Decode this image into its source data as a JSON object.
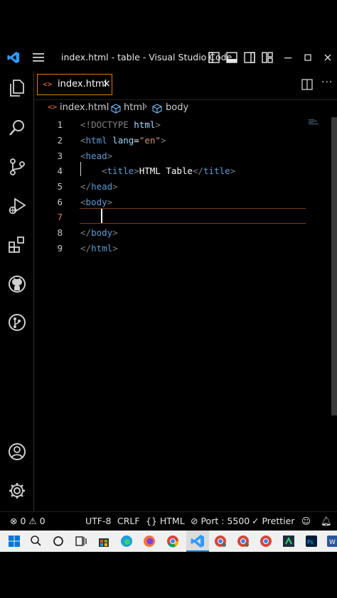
{
  "window": {
    "title": "index.html - table - Visual Studio Code"
  },
  "tab": {
    "icon": "<>",
    "label": "index.html",
    "close": "×"
  },
  "breadcrumb": {
    "file": "index.html",
    "items": [
      "html",
      "body"
    ]
  },
  "editor": {
    "lines": [
      {
        "n": "1"
      },
      {
        "n": "2"
      },
      {
        "n": "3"
      },
      {
        "n": "4"
      },
      {
        "n": "5"
      },
      {
        "n": "6"
      },
      {
        "n": "7"
      },
      {
        "n": "8"
      },
      {
        "n": "9"
      }
    ],
    "code": {
      "l1_open": "<!",
      "l1_kw": "DOCTYPE",
      "l1_rest": " html",
      "l1_close": ">",
      "l2_open": "<",
      "l2_tag": "html",
      "l2_attr": " lang",
      "l2_eq": "=",
      "l2_val": "\"en\"",
      "l2_close": ">",
      "l3_open": "<",
      "l3_tag": "head",
      "l3_close": ">",
      "l4_open": "<",
      "l4_tag": "title",
      "l4_close": ">",
      "l4_text": "HTML Table",
      "l4_end_open": "</",
      "l4_end_tag": "title",
      "l4_end_close": ">",
      "l5_open": "</",
      "l5_tag": "head",
      "l5_close": ">",
      "l6_open": "<",
      "l6_tag": "body",
      "l6_close": ">",
      "l8_open": "</",
      "l8_tag": "body",
      "l8_close": ">",
      "l9_open": "</",
      "l9_tag": "html",
      "l9_close": ">"
    },
    "active_line": "7"
  },
  "statusbar": {
    "errors": "0",
    "warnings": "0",
    "encoding": "UTF-8",
    "eol": "CRLF",
    "language": "HTML",
    "port": "Port : 5500",
    "prettier": "Prettier"
  },
  "colors": {
    "accent_tab_border": "#e07b00",
    "active_line_border": "#7a3e12",
    "vscode_blue": "#2f9bff"
  }
}
